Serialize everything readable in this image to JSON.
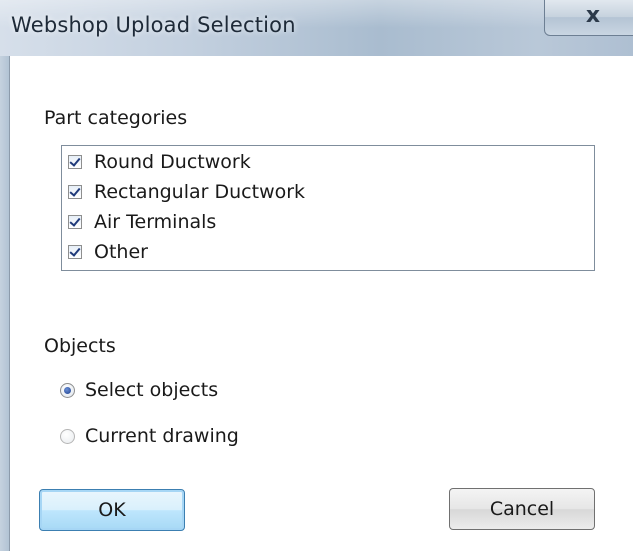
{
  "window": {
    "title": "Webshop Upload Selection",
    "close_glyph": "x"
  },
  "part_categories": {
    "label": "Part categories",
    "items": [
      {
        "label": "Round Ductwork",
        "checked": true
      },
      {
        "label": "Rectangular Ductwork",
        "checked": true
      },
      {
        "label": "Air Terminals",
        "checked": true
      },
      {
        "label": "Other",
        "checked": true
      }
    ]
  },
  "objects": {
    "label": "Objects",
    "options": [
      {
        "label": "Select objects",
        "selected": true
      },
      {
        "label": "Current drawing",
        "selected": false
      }
    ]
  },
  "buttons": {
    "ok_label": "OK",
    "cancel_label": "Cancel"
  },
  "icons": {
    "close": "close-icon",
    "checkbox": "checkbox-checked-icon",
    "radio_on": "radio-selected-icon",
    "radio_off": "radio-unselected-icon"
  },
  "colors": {
    "titlebar": "#b9c8d8",
    "default_button_border": "#3c7fb1",
    "check_mark": "#1f3a7a"
  }
}
